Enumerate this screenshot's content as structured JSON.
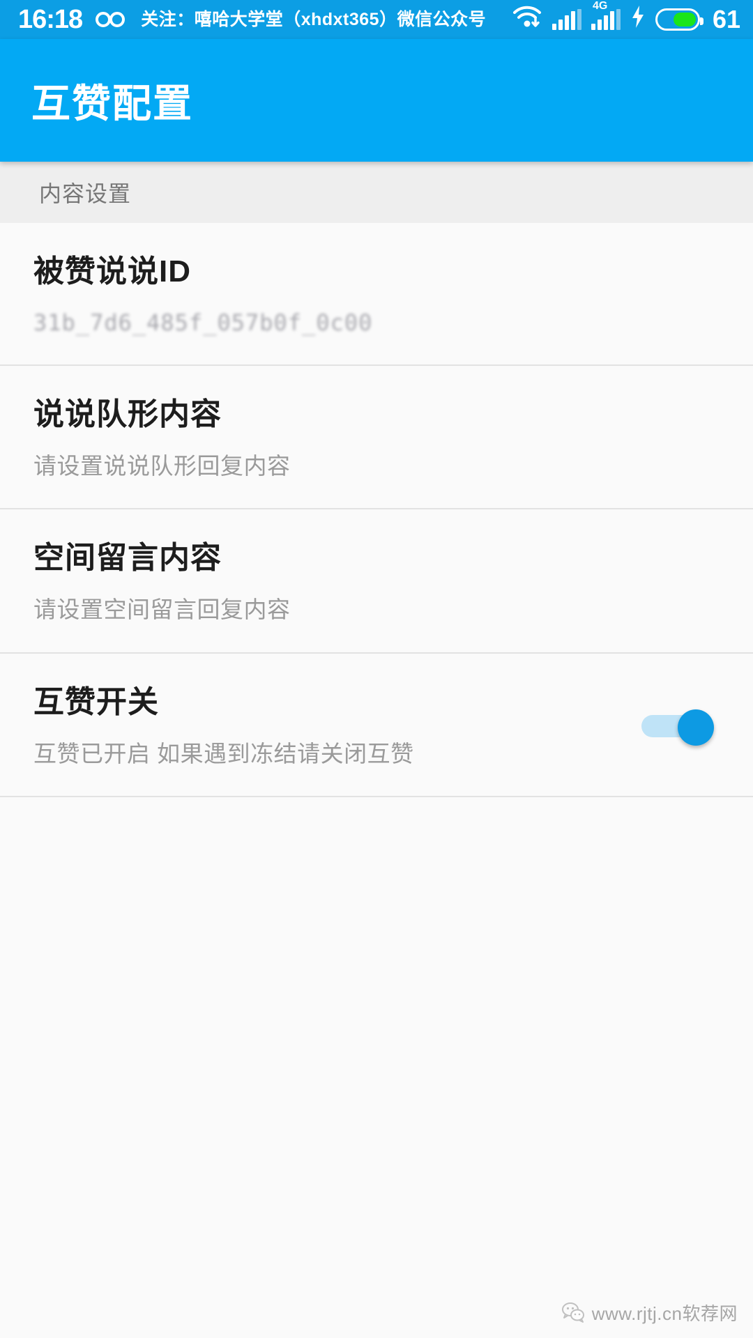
{
  "status_bar": {
    "time": "16:18",
    "ticker": "关注：嘻哈大学堂（xhdxt365）微信公众号",
    "network_label": "4G",
    "battery_percent": "61",
    "icons": {
      "infinity": "infinity-icon",
      "wifi": "wifi-download-icon",
      "signal": "signal-bars-icon",
      "signal_4g": "signal-4g-bars-icon",
      "charging": "charging-bolt-icon",
      "battery": "battery-icon"
    },
    "colors": {
      "background": "#0c9ee4",
      "battery_fill": "#1ae51a"
    }
  },
  "app_bar": {
    "title": "互赞配置",
    "color": "#03a9f4"
  },
  "content": {
    "section_title": "内容设置",
    "items": [
      {
        "title": "被赞说说ID",
        "subtitle": "31b_7d6_485f_057b0f_0c00",
        "blurred": true,
        "type": "value"
      },
      {
        "title": "说说队形内容",
        "subtitle": "请设置说说队形回复内容",
        "blurred": false,
        "type": "value"
      },
      {
        "title": "空间留言内容",
        "subtitle": "请设置空间留言回复内容",
        "blurred": false,
        "type": "value"
      },
      {
        "title": "互赞开关",
        "subtitle": "互赞已开启 如果遇到冻结请关闭互赞",
        "blurred": false,
        "type": "switch",
        "switch_on": true,
        "switch_color": "#0d9ae3"
      }
    ]
  },
  "watermark": {
    "text": "www.rjtj.cn软荐网",
    "icon": "wechat-icon"
  }
}
